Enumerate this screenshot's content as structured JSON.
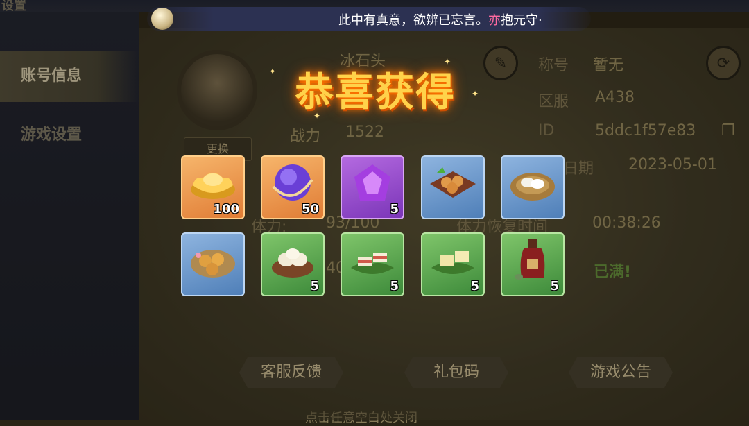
{
  "window": {
    "title": "设置"
  },
  "banner": {
    "quote_main": "此中有真意，欲辨已忘言。",
    "quote_accent": "亦",
    "quote_tail": "抱元守·"
  },
  "sidebar": {
    "items": [
      {
        "label": "账号信息",
        "active": true
      },
      {
        "label": "游戏设置",
        "active": false
      }
    ]
  },
  "profile": {
    "name": "冰石头",
    "power_label": "战力",
    "power_value": "1522",
    "change_button": "更换",
    "title_label": "称号",
    "title_value": "暂无",
    "server_label": "区服",
    "server_value": "A438",
    "id_label": "ID",
    "id_value": "5ddc1f57e83",
    "date_label": "日期",
    "date_value": "2023-05-01",
    "stamina_label": "体力:",
    "stamina_value": "93/100",
    "recover_label": "体力恢复时间",
    "recover_value": "00:38:26",
    "full_value": "已满!",
    "partial_value": "40"
  },
  "buttons": {
    "feedback": "客服反馈",
    "gift_code": "礼包码",
    "announcement": "游戏公告"
  },
  "hint": "点击任意空白处关闭",
  "reward": {
    "title": "恭喜获得",
    "items": [
      {
        "name": "gold-ingot",
        "quantity": "100",
        "rarity": "orange"
      },
      {
        "name": "purple-orb",
        "quantity": "50",
        "rarity": "orange"
      },
      {
        "name": "purple-gem",
        "quantity": "5",
        "rarity": "purple"
      },
      {
        "name": "pastry-tray",
        "quantity": "",
        "rarity": "blue"
      },
      {
        "name": "rice-cake-basket",
        "quantity": "",
        "rarity": "blue"
      },
      {
        "name": "mooncake-plate",
        "quantity": "",
        "rarity": "blue"
      },
      {
        "name": "rolled-pastry",
        "quantity": "5",
        "rarity": "green"
      },
      {
        "name": "sandwich-cake",
        "quantity": "5",
        "rarity": "green"
      },
      {
        "name": "layered-cake",
        "quantity": "5",
        "rarity": "green"
      },
      {
        "name": "wine-jar",
        "quantity": "5",
        "rarity": "green"
      }
    ]
  },
  "colors": {
    "congrats_gold": "#ffd24a",
    "accent_pink": "#ff6aa0",
    "full_green": "#6fa041"
  }
}
